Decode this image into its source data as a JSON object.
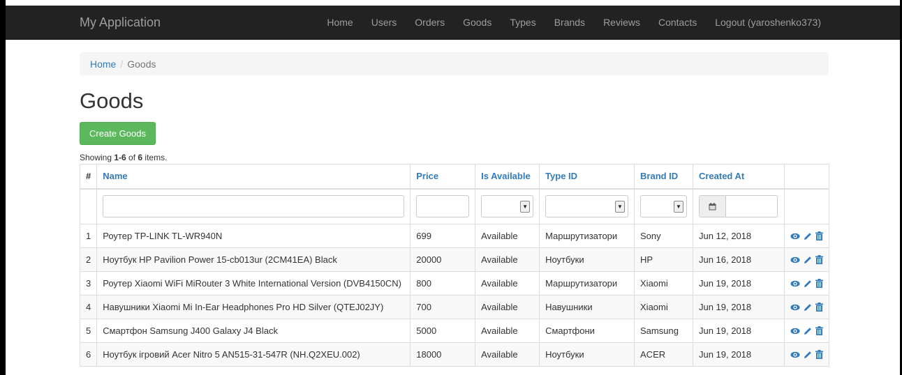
{
  "navbar": {
    "brand": "My Application",
    "links": [
      "Home",
      "Users",
      "Orders",
      "Goods",
      "Types",
      "Brands",
      "Reviews",
      "Contacts",
      "Logout (yaroshenko373)"
    ]
  },
  "breadcrumb": {
    "home": "Home",
    "separator": "/",
    "current": "Goods"
  },
  "page": {
    "title": "Goods",
    "create_button": "Create Goods",
    "summary": {
      "prefix": "Showing ",
      "range": "1-6",
      "middle": " of ",
      "total": "6",
      "suffix": " items."
    }
  },
  "table": {
    "headers": [
      "#",
      "Name",
      "Price",
      "Is Available",
      "Type ID",
      "Brand ID",
      "Created At",
      ""
    ],
    "rows": [
      {
        "num": "1",
        "name": "Роутер TP-LINK TL-WR940N",
        "price": "699",
        "available": "Available",
        "type": "Маршрутизатори",
        "brand": "Sony",
        "created": "Jun 12, 2018"
      },
      {
        "num": "2",
        "name": "Ноутбук HP Pavilion Power 15-cb013ur (2CM41EA) Black",
        "price": "20000",
        "available": "Available",
        "type": "Ноутбуки",
        "brand": "HP",
        "created": "Jun 16, 2018"
      },
      {
        "num": "3",
        "name": "Роутер Xiaomi WiFi MiRouter 3 White International Version (DVB4150CN)",
        "price": "800",
        "available": "Available",
        "type": "Маршрутизатори",
        "brand": "Xiaomi",
        "created": "Jun 19, 2018"
      },
      {
        "num": "4",
        "name": "Навушники Xiaomi Mi In-Ear Headphones Pro HD Silver (QTEJ02JY)",
        "price": "700",
        "available": "Available",
        "type": "Навушники",
        "brand": "Xiaomi",
        "created": "Jun 19, 2018"
      },
      {
        "num": "5",
        "name": "Смартфон Samsung J400 Galaxy J4 Black",
        "price": "5000",
        "available": "Available",
        "type": "Смартфони",
        "brand": "Samsung",
        "created": "Jun 19, 2018"
      },
      {
        "num": "6",
        "name": "Ноутбук ігровий Acer Nitro 5 AN515-31-547R (NH.Q2XEU.002)",
        "price": "18000",
        "available": "Available",
        "type": "Ноутбуки",
        "brand": "ACER",
        "created": "Jun 19, 2018"
      }
    ],
    "row_actions": [
      "eye-icon",
      "pencil-icon",
      "trash-icon"
    ]
  },
  "colors": {
    "navbar_bg": "#222222",
    "link": "#337ab7",
    "create_button": "#5cb85c",
    "breadcrumb_bg": "#f5f5f5"
  }
}
